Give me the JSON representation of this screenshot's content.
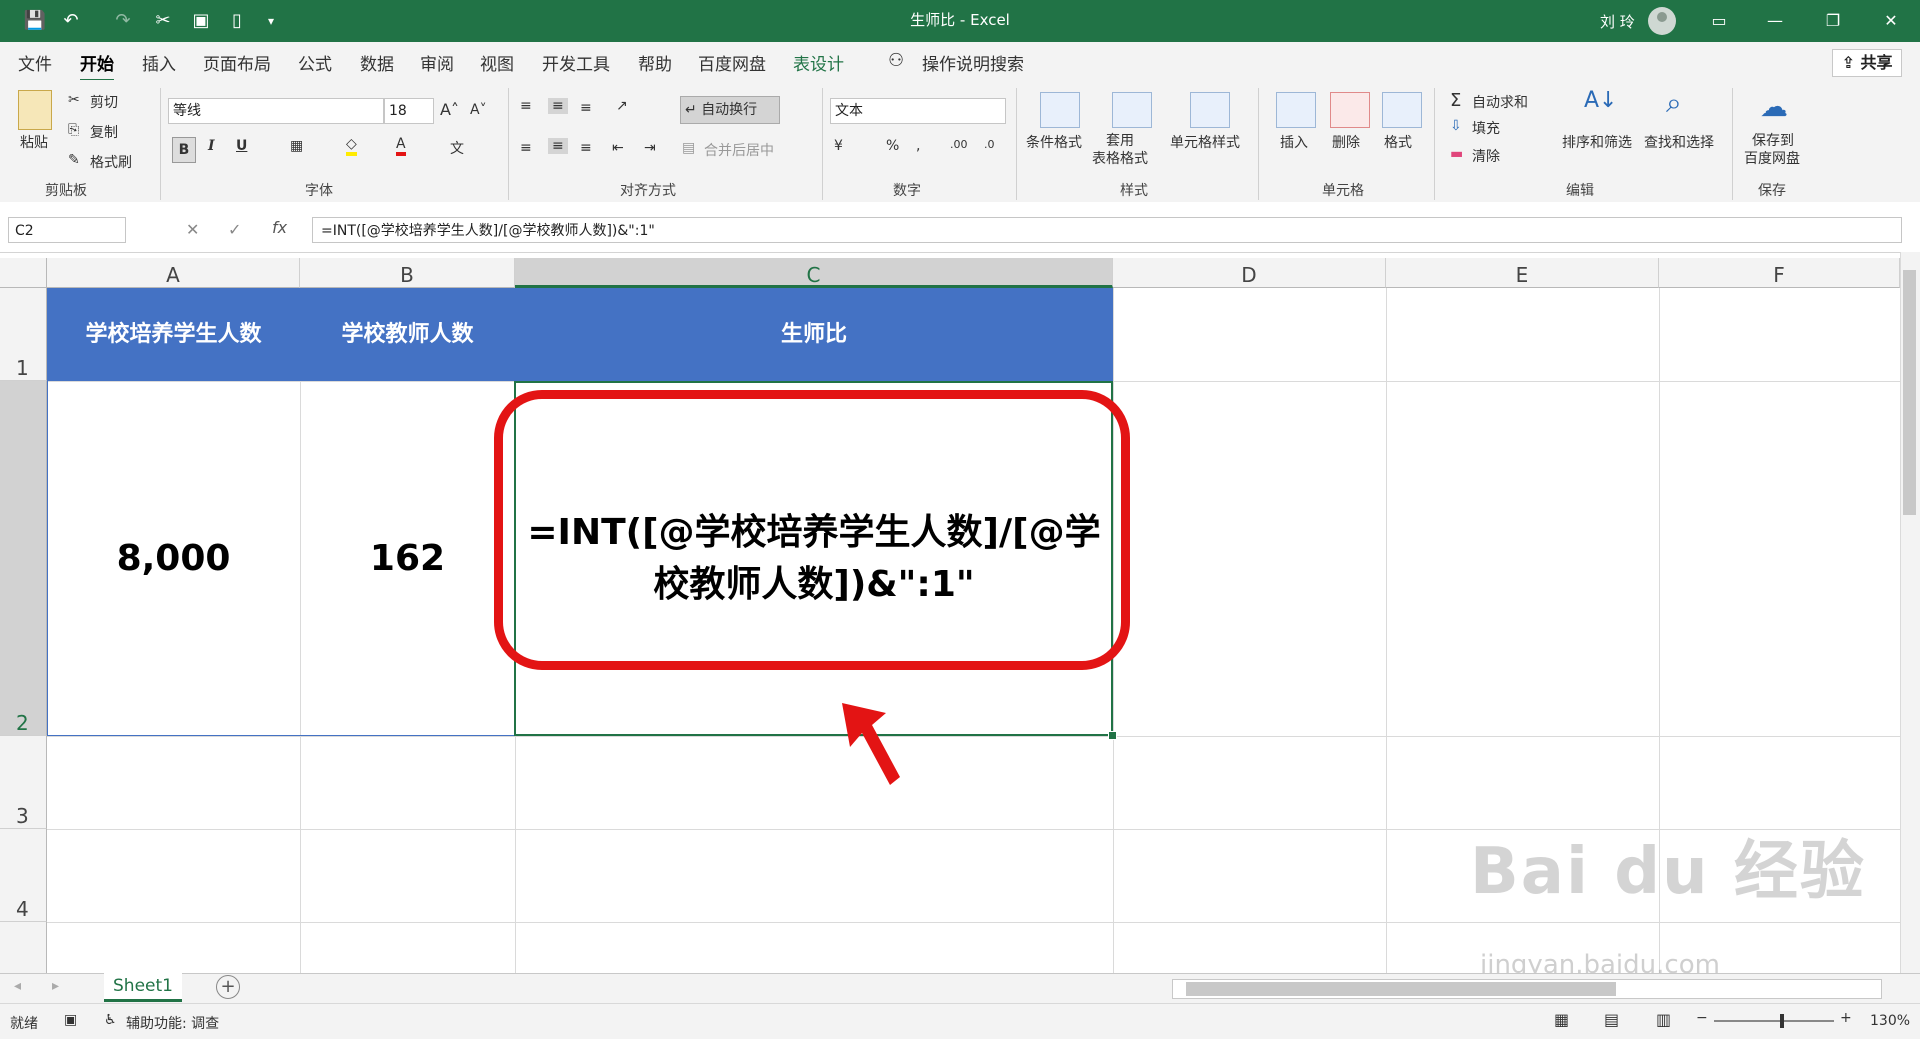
{
  "window": {
    "title": "生师比 - Excel",
    "user": "刘 玲"
  },
  "quick_access": {
    "save": "save",
    "undo": "undo",
    "redo": "redo",
    "cut": "cut",
    "printpreview": "print-preview",
    "new": "new"
  },
  "tabs": [
    "文件",
    "开始",
    "插入",
    "页面布局",
    "公式",
    "数据",
    "审阅",
    "视图",
    "开发工具",
    "帮助",
    "百度网盘",
    "表设计"
  ],
  "tell_me": "操作说明搜索",
  "share": "共享",
  "ribbon": {
    "clipboard": {
      "paste": "粘贴",
      "cut": "剪切",
      "copy": "复制",
      "format_painter": "格式刷",
      "group": "剪贴板"
    },
    "font": {
      "name": "等线",
      "size": "18",
      "bold": "B",
      "italic": "I",
      "underline": "U",
      "group": "字体"
    },
    "alignment": {
      "wrap": "自动换行",
      "merge": "合并后居中",
      "group": "对齐方式"
    },
    "number": {
      "format": "文本",
      "percent": "%",
      "group": "数字"
    },
    "styles": {
      "conditional": "条件格式",
      "table": "套用\n表格格式",
      "cell_style": "单元格样式",
      "group": "样式"
    },
    "cells": {
      "insert": "插入",
      "delete": "删除",
      "format": "格式",
      "group": "单元格"
    },
    "editing": {
      "autosum": "自动求和",
      "fill": "填充",
      "clear": "清除",
      "sort": "排序和筛选",
      "find": "查找和选择",
      "group": "编辑"
    },
    "save": {
      "label1": "保存到",
      "label2": "百度网盘",
      "group": "保存"
    }
  },
  "formula_bar": {
    "name_box": "C2",
    "fx": "fx",
    "formula": "=INT([@学校培养学生人数]/[@学校教师人数])&\":1\""
  },
  "columns": [
    "A",
    "B",
    "C",
    "D",
    "E",
    "F"
  ],
  "rows": [
    "1",
    "2",
    "3",
    "4"
  ],
  "table": {
    "headers": [
      "学校培养学生人数",
      "学校教师人数",
      "生师比"
    ],
    "row2": [
      "8,000",
      "162",
      "=INT([@学校培养学生人数]/[@学校教师人数])&\":1\""
    ]
  },
  "sheets": [
    "Sheet1"
  ],
  "status": {
    "ready": "就绪",
    "accessibility": "辅助功能: 调查",
    "zoom": "130%"
  },
  "watermark": {
    "text": "Bai du 经验",
    "url": "jingyan.baidu.com"
  },
  "colors": {
    "excel_green": "#217346",
    "table_header": "#4472c4",
    "annotation_red": "#e31414"
  }
}
